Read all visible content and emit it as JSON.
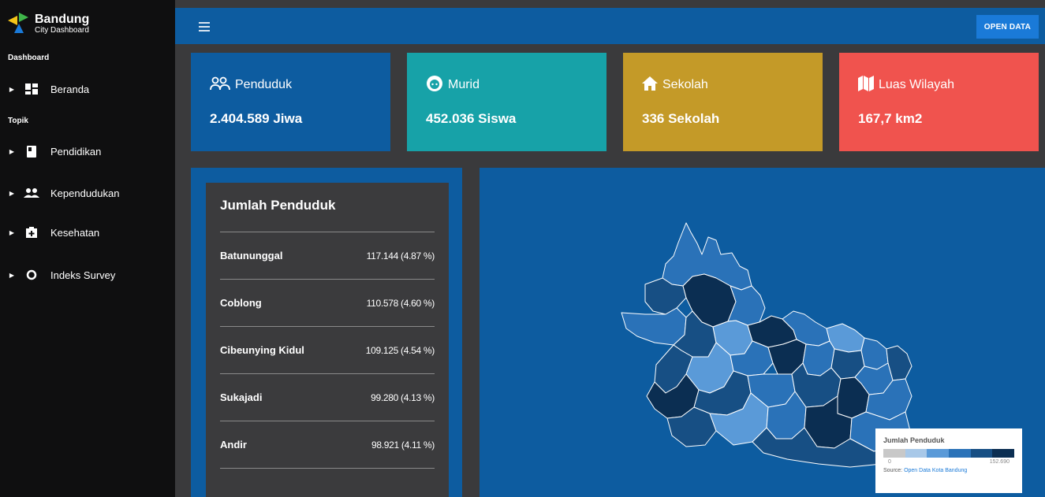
{
  "brand": {
    "title": "Bandung",
    "subtitle": "City Dashboard"
  },
  "sidebar": {
    "section_dashboard": "Dashboard",
    "section_topik": "Topik",
    "items": [
      {
        "label": "Beranda",
        "icon": "dashboard-icon"
      },
      {
        "label": "Pendidikan",
        "icon": "book-icon"
      },
      {
        "label": "Kependudukan",
        "icon": "people-icon"
      },
      {
        "label": "Kesehatan",
        "icon": "medical-icon"
      },
      {
        "label": "Indeks Survey",
        "icon": "circle-icon"
      }
    ]
  },
  "topbar": {
    "open_data_label": "OPEN DATA"
  },
  "cards": [
    {
      "title": "Penduduk",
      "value": "2.404.589 Jiwa",
      "color": "#0d5ca0",
      "icon": "people-outline-icon"
    },
    {
      "title": "Murid",
      "value": "452.036 Siswa",
      "color": "#17a2a8",
      "icon": "face-icon"
    },
    {
      "title": "Sekolah",
      "value": "336 Sekolah",
      "color": "#c49a28",
      "icon": "home-icon"
    },
    {
      "title": "Luas Wilayah",
      "value": "167,7 km2",
      "color": "#f0534e",
      "icon": "map-icon"
    }
  ],
  "ranking": {
    "title": "Jumlah Penduduk",
    "rows": [
      {
        "name": "Batununggal",
        "value": "117.144 (4.87 %)"
      },
      {
        "name": "Coblong",
        "value": "110.578 (4.60 %)"
      },
      {
        "name": "Cibeunying Kidul",
        "value": "109.125 (4.54 %)"
      },
      {
        "name": "Sukajadi",
        "value": "99.280 (4.13 %)"
      },
      {
        "name": "Andir",
        "value": "98.921 (4.11 %)"
      }
    ]
  },
  "legend": {
    "title": "Jumlah Penduduk",
    "min": "0",
    "max": "152.690",
    "source_prefix": "Source:",
    "source_link": "Open Data Kota Bandung",
    "colors": [
      "#c8c8c8",
      "#a8c8e8",
      "#5a9ad8",
      "#2a72b8",
      "#174f84",
      "#0b2e52"
    ]
  }
}
